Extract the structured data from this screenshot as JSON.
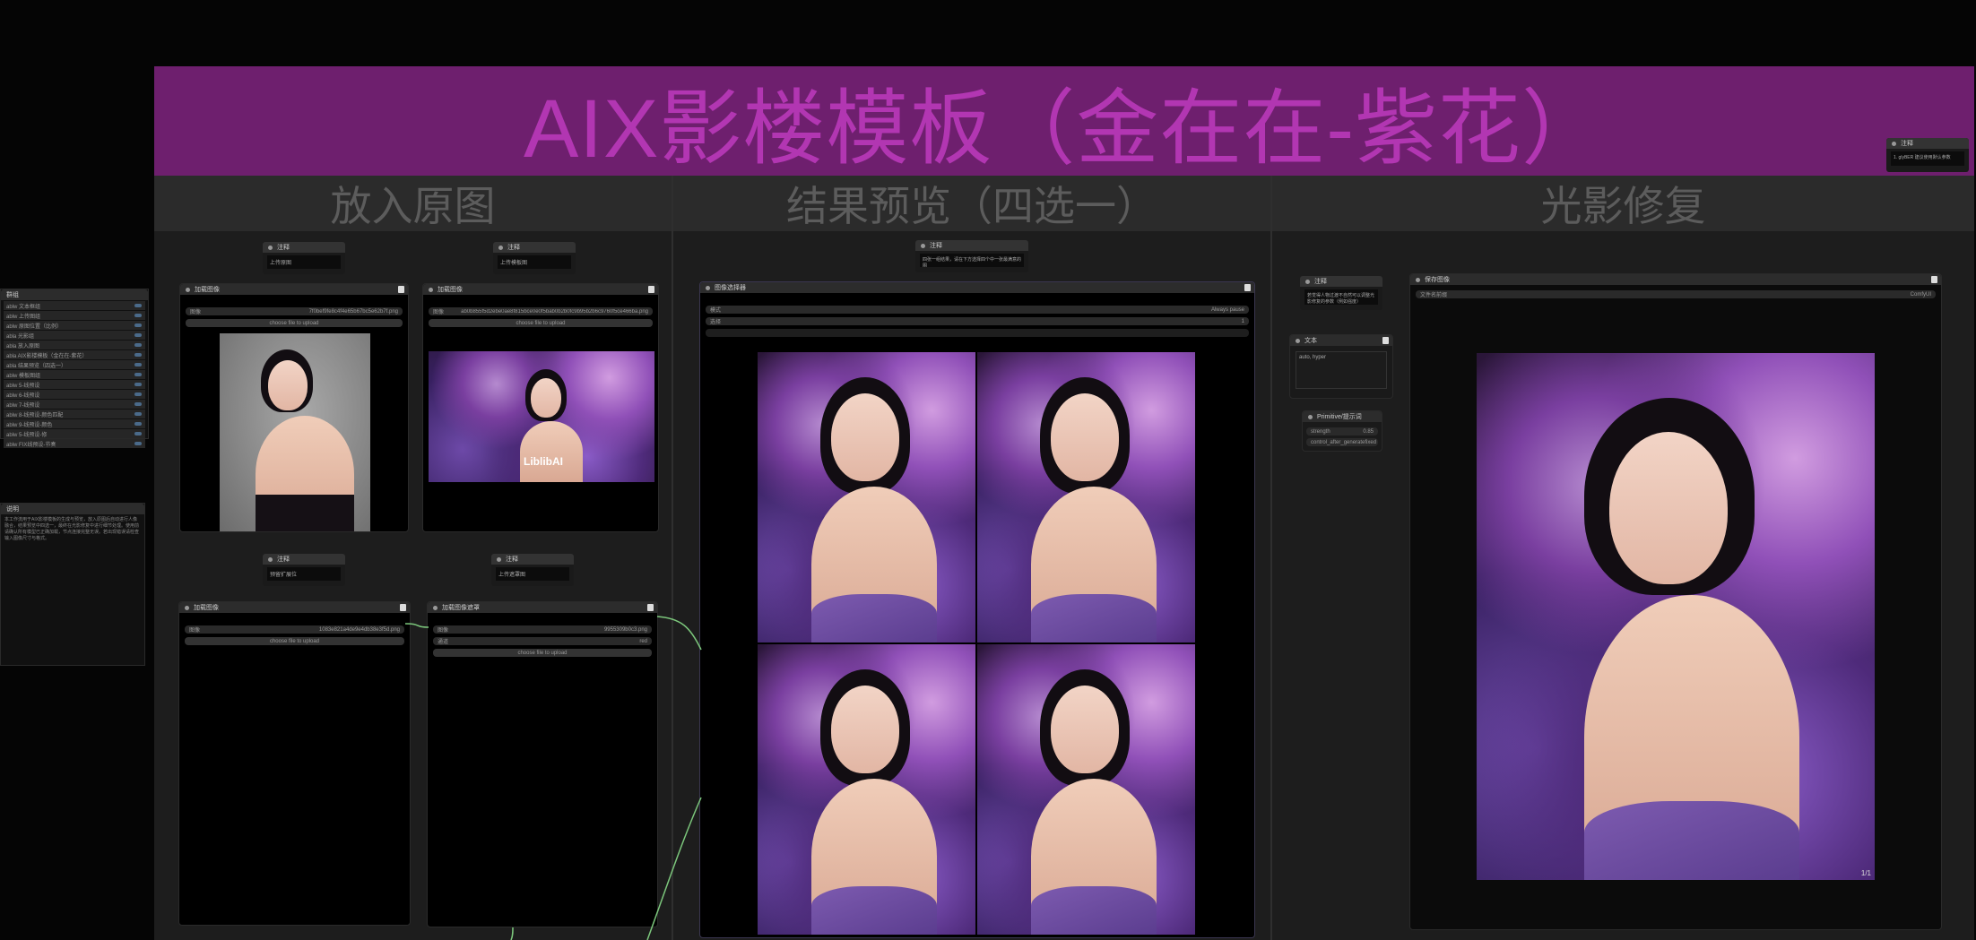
{
  "group": {
    "title": "AIX影楼模板（金在在-紫花）",
    "header_color": "#6e1f6e",
    "title_color": "#b236b2",
    "sections": [
      "放入原图",
      "结果预览（四选一）",
      "光影修复"
    ]
  },
  "left_panels": {
    "groups_panel": {
      "title": "群组",
      "rows": [
        "ablw 文本框组",
        "ablw 上传图组",
        "ablw 原图位置（比例）",
        "abla 光影组",
        "abla 放入原图",
        "abla AIX影楼模板（金在在-紫花）",
        "abla 结果预览（四选一）",
        "ablw 模板图组",
        "ablw 5-线预设",
        "ablw 6-线预设",
        "ablw 7-线预设",
        "ablw 8-线预设-颜色匹配",
        "ablw 9-线预设-颜色",
        "ablw 5-线预设-修",
        "ablw FIX线预设-节奏"
      ]
    },
    "notes_panel": {
      "title": "说明",
      "text": "本工作流用于AIX影楼模板的生成与预览，放入原图后自动进行人像融合，结果预览中四选一，最终在光影修复中进行细节处理。使用前请确认所有模型已正确加载，节点连接完整无误。若出现错误请检查输入图像尺寸与格式。"
    }
  },
  "nodes": {
    "note_1": {
      "title": "注释",
      "text": "上传原图"
    },
    "note_2": {
      "title": "注释",
      "text": "上传模板图"
    },
    "note_3": {
      "title": "注释",
      "text": "预留扩展位"
    },
    "note_4": {
      "title": "注释",
      "text": "上传遮罩图"
    },
    "note_5": {
      "title": "注释",
      "text": "四张一组结果，请在下方选择四个中一张最满意的图"
    },
    "note_6": {
      "title": "注释",
      "text": "若觉得人物过渡不自然可以调整光影修复的参数（例如强度）"
    },
    "note_7": {
      "title": "注释",
      "text": "1. glyBER 建议使用默认参数"
    },
    "load_image_1": {
      "title": "加载图像",
      "image_label": "图像",
      "filename": "7f0bef9fe8c4f4e65b67bc5e62b7f.png",
      "upload": "choose file to upload"
    },
    "load_image_2": {
      "title": "加载图像",
      "image_label": "图像",
      "filename": "ab0b855f5d2ebe0ae8f815bce0e0f5bab0b2b0fc9b95b2b6c9760f5ce466ba.png",
      "upload": "choose file to upload"
    },
    "load_image_3": {
      "title": "加载图像",
      "image_label": "图像",
      "filename": "1083e821a4de9e4db38e3f5d.png",
      "upload": "choose file to upload"
    },
    "load_image_4": {
      "title": "加载图像遮罩",
      "image_label": "图像",
      "filename": "9955309b0c3.png",
      "channel_label": "通道",
      "channel_value": "red",
      "upload": "choose file to upload"
    },
    "preview_node": {
      "title": "图像选择器",
      "row1_label": "模式",
      "row1_value": "Always pause",
      "row2_label": "选择",
      "row2_value": "1"
    },
    "text_node": {
      "title": "文本",
      "text": "auto, hyper"
    },
    "prompt_node": {
      "title": "Primitive/提示词",
      "row1_label": "strength",
      "row1_value": "0.85",
      "row2_label": "control_after_generate",
      "row2_value": "fixed"
    },
    "relight_node": {
      "title": "保存图像",
      "prefix_label": "文件名前缀",
      "prefix_value": "ComfyUI",
      "corner_text": "1/1"
    },
    "top_note": {
      "title": "注释",
      "text": "1. glyBER\n建议使用默认参数"
    }
  },
  "colors": {
    "link_green": "#7cc77c",
    "link_gray": "#666666"
  },
  "watermark": "LiblibAI"
}
